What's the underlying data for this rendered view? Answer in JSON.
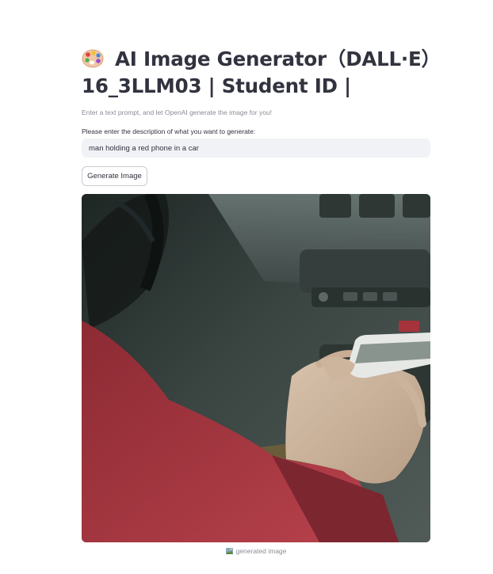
{
  "page": {
    "title_line1": "AI Image Generator（DALL·E）",
    "title_line2": "16_3LLM03 | Student ID |",
    "caption": "Enter a text prompt, and let OpenAI generate the image for you!"
  },
  "prompt": {
    "label": "Please enter the description of what you want to generate:",
    "value": "man holding a red phone in a car"
  },
  "button": {
    "label": "Generate Image"
  },
  "result": {
    "caption": "generated image",
    "icon": "image-icon"
  },
  "icons": {
    "title": "palette-icon"
  },
  "colors": {
    "text": "#31333f",
    "input_bg": "#f0f2f6",
    "muted": "#8b8d96"
  }
}
